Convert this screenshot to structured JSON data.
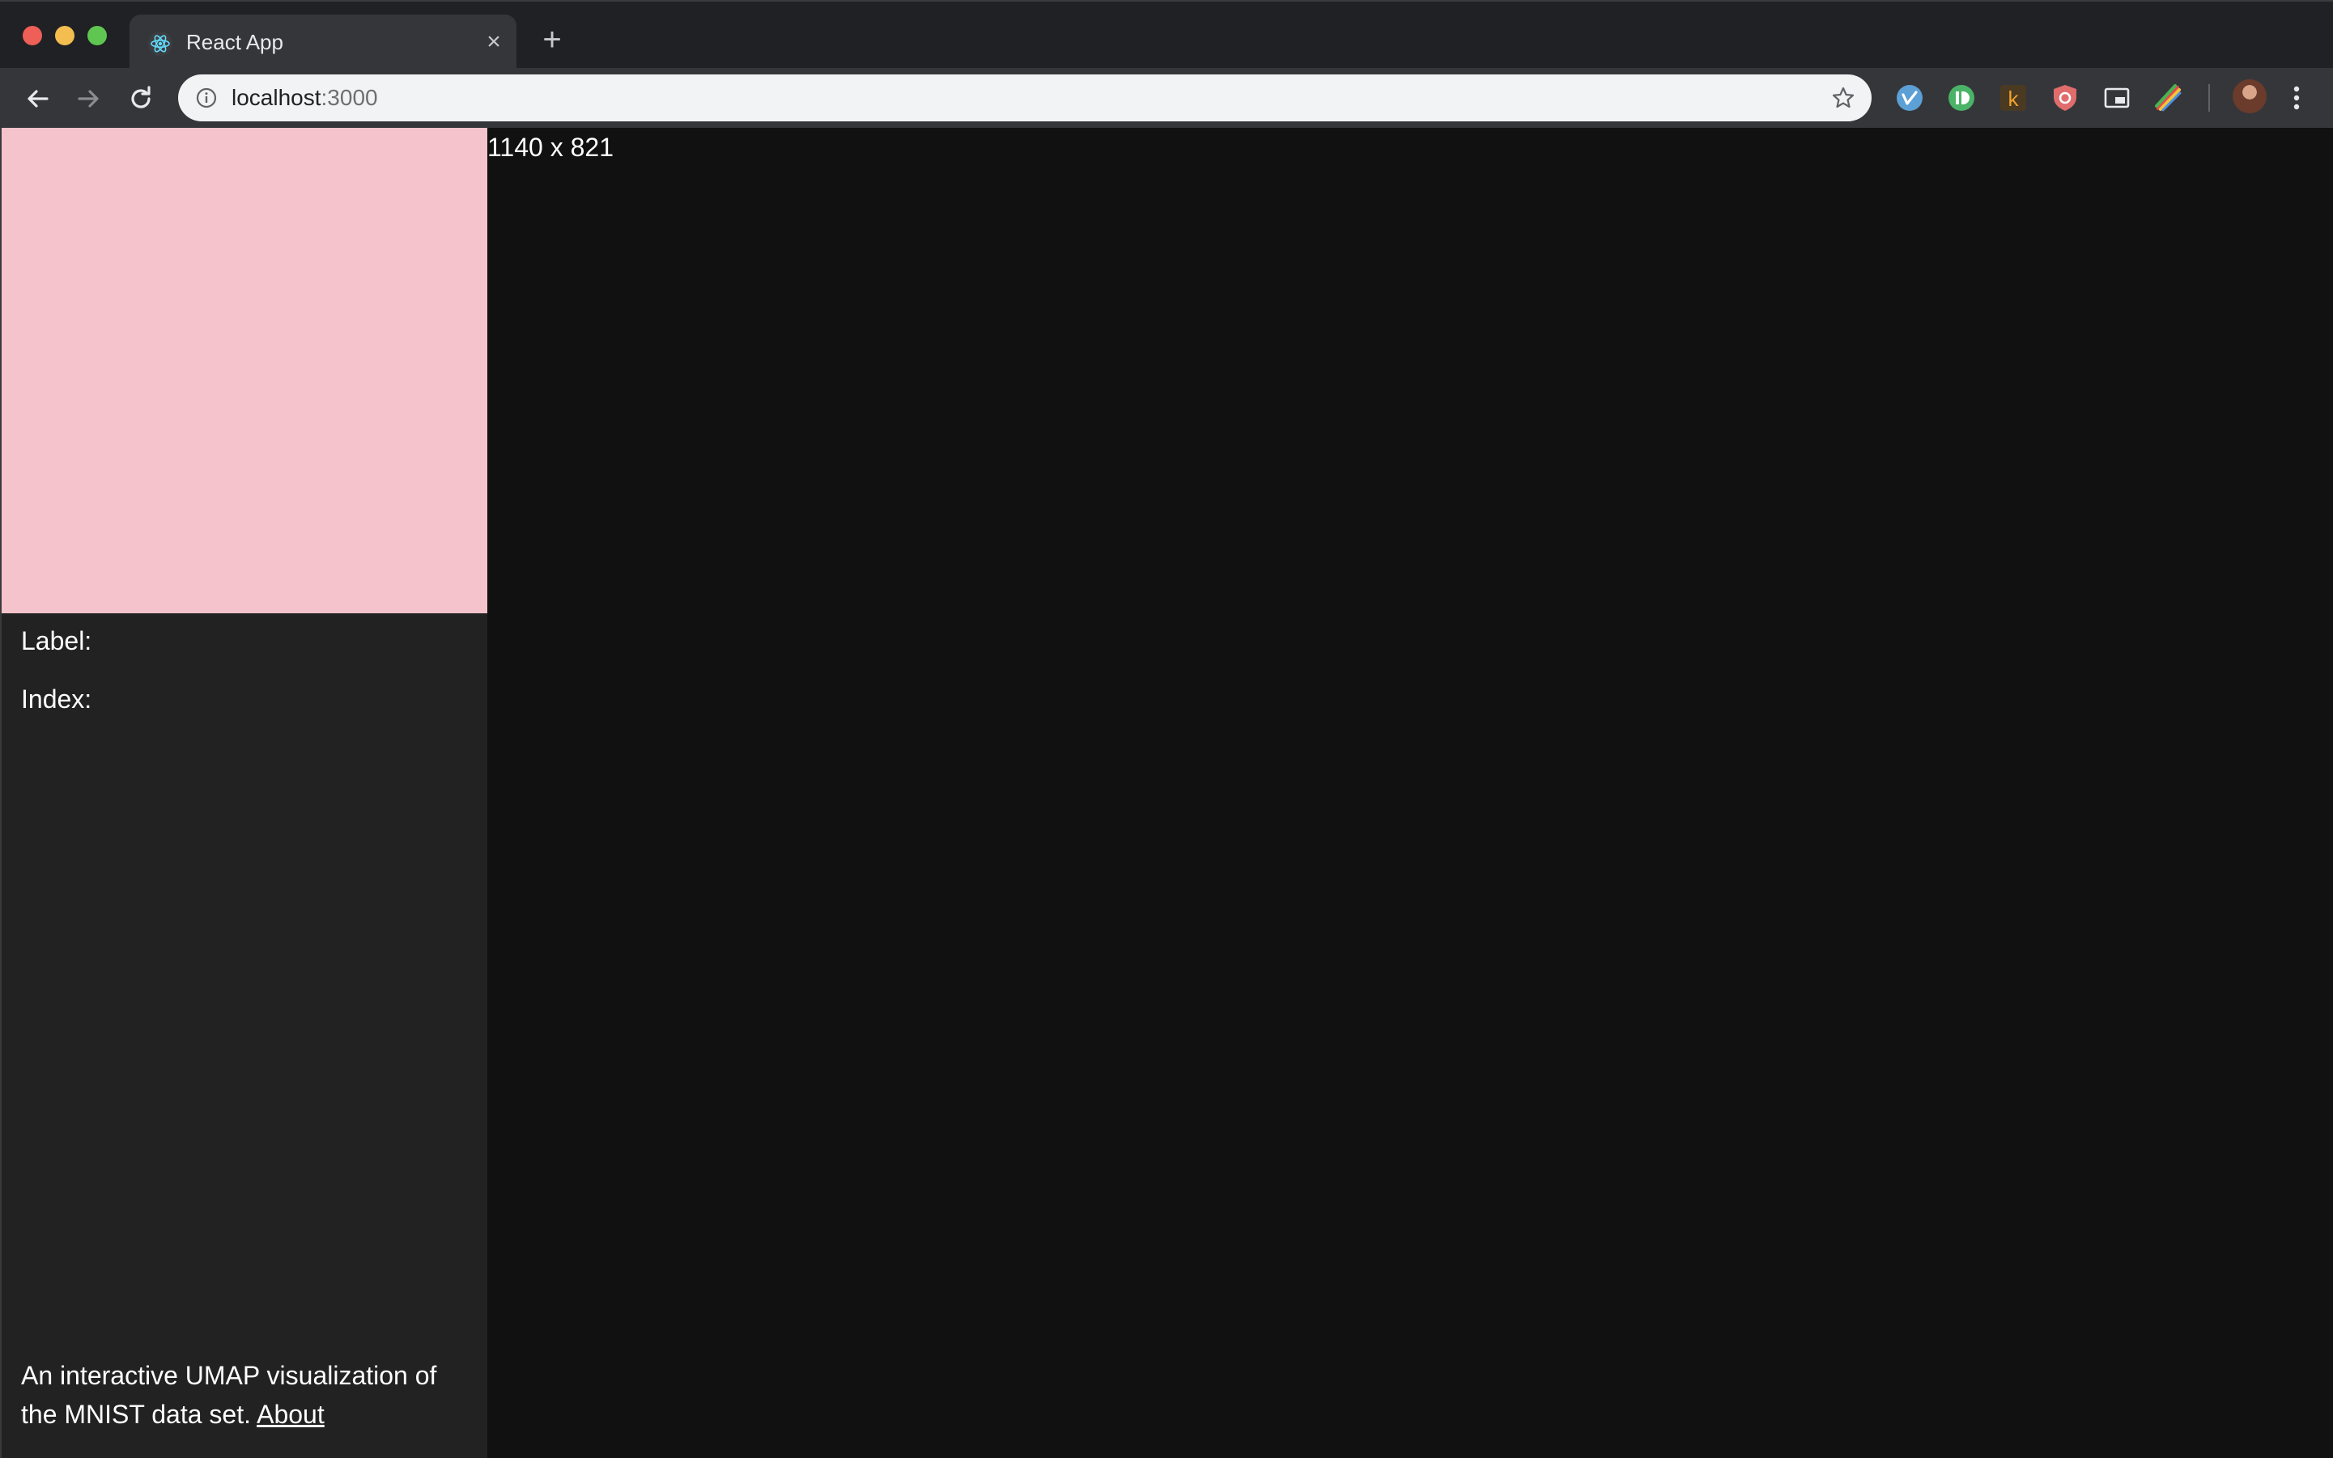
{
  "browser": {
    "tab_title": "React App",
    "tab_close": "×",
    "new_tab": "+",
    "url_host": "localhost",
    "url_port": ":3000"
  },
  "extensions": [
    "vimeo-icon",
    "pushbullet-icon",
    "k-extension-icon",
    "shield-extension-icon",
    "picture-in-picture-icon",
    "rainbow-brush-icon"
  ],
  "sidebar": {
    "label_text": "Label:",
    "index_text": "Index:",
    "description": "An interactive UMAP visualization of the MNIST data set.",
    "about_link": "About"
  },
  "canvas": {
    "dimensions": "1140 x 821"
  },
  "colors": {
    "preview": "#f5c3cb",
    "sidebar": "#222222",
    "canvas": "#111111"
  }
}
